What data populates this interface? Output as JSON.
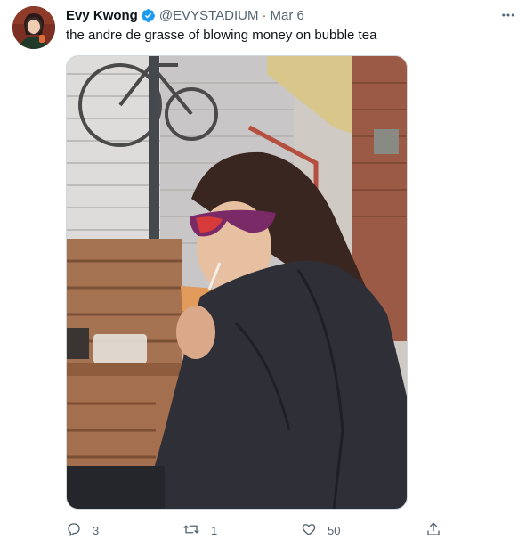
{
  "tweet": {
    "author_name": "Evy Kwong",
    "handle": "@EVYSTADIUM",
    "separator": "·",
    "date": "Mar 6",
    "text": "the andre de grasse of blowing money on bubble tea",
    "verified": true,
    "image_description": "photo"
  },
  "actions": {
    "reply_count": "3",
    "retweet_count": "1",
    "like_count": "50",
    "share_count": ""
  },
  "colors": {
    "verified_blue": "#1d9bf0",
    "secondary_text": "#536471"
  },
  "icons": [
    "verified-badge-icon",
    "more-icon",
    "reply-icon",
    "retweet-icon",
    "like-icon",
    "share-icon"
  ]
}
